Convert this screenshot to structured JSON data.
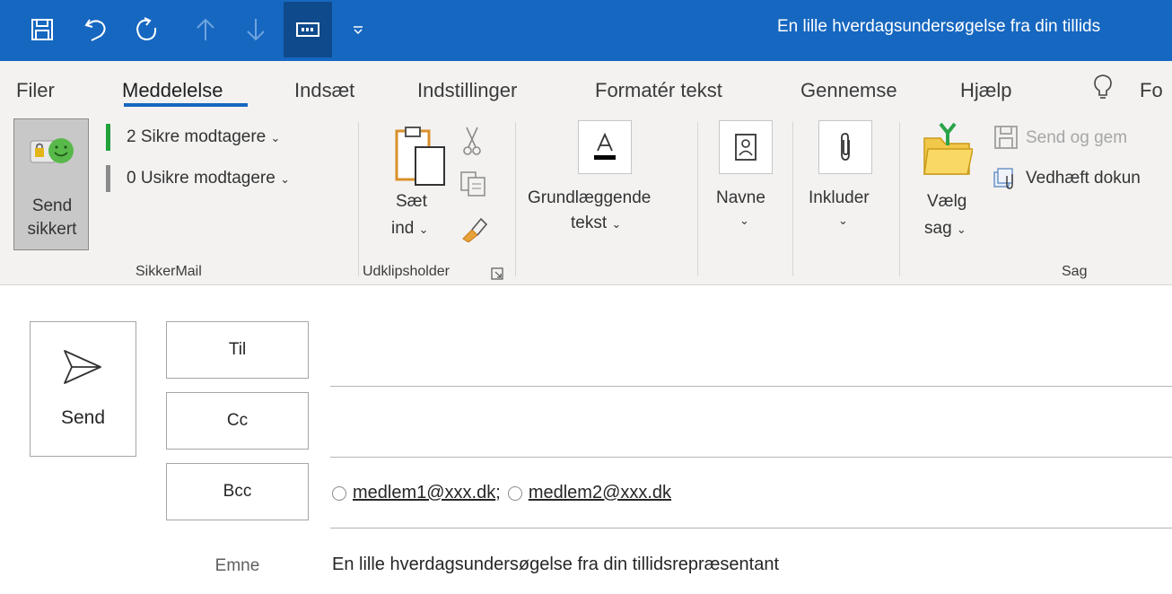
{
  "window": {
    "title": "En lille hverdagsundersøgelse fra din tillids",
    "quick_access": [
      "save-icon",
      "undo-icon",
      "redo-icon",
      "up-arrow-icon",
      "down-arrow-icon",
      "touch-mode-icon",
      "customize-dropdown-icon"
    ]
  },
  "menu": {
    "tabs": [
      "Filer",
      "Meddelelse",
      "Indsæt",
      "Indstillinger",
      "Formatér tekst",
      "Gennemse",
      "Hjælp",
      "Fo"
    ],
    "active_tab": "Meddelelse",
    "tell_me_icon": "lightbulb-icon"
  },
  "ribbon": {
    "sikkermail": {
      "send_secure_line1": "Send",
      "send_secure_line2": "sikkert",
      "secure_recipients": "2 Sikre modtagere",
      "unsecure_recipients": "0 Usikre modtagere",
      "group_label": "SikkerMail",
      "secure_color": "#22a13a",
      "unsecure_color": "#8a8a8a"
    },
    "clipboard": {
      "paste_line1": "Sæt",
      "paste_line2": "ind",
      "group_label": "Udklipsholder"
    },
    "basic_text": {
      "line1": "Grundlæggende",
      "line2": "tekst"
    },
    "names": {
      "label": "Navne"
    },
    "include": {
      "label": "Inkluder"
    },
    "case": {
      "choose_line1": "Vælg",
      "choose_line2": "sag",
      "send_and_save": "Send og gem",
      "attach_document": "Vedhæft dokun",
      "group_label": "Sag"
    }
  },
  "compose": {
    "send_label": "Send",
    "to_label": "Til",
    "cc_label": "Cc",
    "bcc_label": "Bcc",
    "bcc_recipients": [
      "medlem1@xxx.dk",
      "medlem2@xxx.dk"
    ],
    "separator": ";",
    "subject_label": "Emne",
    "subject_value": "En lille hverdagsundersøgelse fra din tillidsrepræsentant"
  },
  "colors": {
    "titlebar": "#1667c0",
    "accent": "#1667c0",
    "ribbon_bg": "#f3f2f1"
  }
}
